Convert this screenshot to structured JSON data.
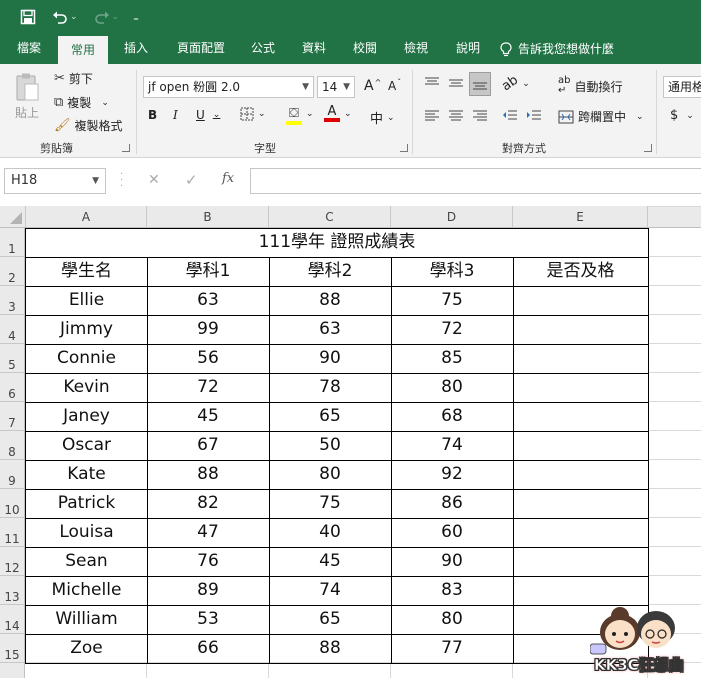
{
  "qat": {
    "save_icon": "save-icon",
    "undo_icon": "undo-icon",
    "redo_icon": "redo-icon",
    "customize_icon": "customize-icon"
  },
  "tabs": [
    {
      "label": "檔案"
    },
    {
      "label": "常用"
    },
    {
      "label": "插入"
    },
    {
      "label": "頁面配置"
    },
    {
      "label": "公式"
    },
    {
      "label": "資料"
    },
    {
      "label": "校閱"
    },
    {
      "label": "檢視"
    },
    {
      "label": "說明"
    },
    {
      "label": "告訴我您想做什麼"
    }
  ],
  "ribbon": {
    "clipboard": {
      "paste": "貼上",
      "cut": "剪下",
      "copy": "複製",
      "format_painter": "複製格式",
      "label": "剪貼簿"
    },
    "font": {
      "name": "jf open 粉圓 2.0",
      "size": "14",
      "grow": "A",
      "shrink": "A",
      "bold": "B",
      "italic": "I",
      "underline": "U",
      "font_color": "A",
      "label": "字型"
    },
    "alignment": {
      "wrap": "自動換行",
      "merge": "跨欄置中",
      "label": "對齊方式"
    },
    "number": {
      "format": "通用格",
      "currency": "$"
    }
  },
  "formula_bar": {
    "name_box": "H18",
    "cancel": "✕",
    "enter": "✓",
    "fx": "fx",
    "value": ""
  },
  "columns": [
    "A",
    "B",
    "C",
    "D",
    "E"
  ],
  "rows": [
    "1",
    "2",
    "3",
    "4",
    "5",
    "6",
    "7",
    "8",
    "9",
    "10",
    "11",
    "12",
    "13",
    "14",
    "15"
  ],
  "sheet": {
    "title": "111學年 證照成績表",
    "headers": [
      "學生名",
      "學科1",
      "學科2",
      "學科3",
      "是否及格"
    ],
    "students": [
      {
        "name": "Ellie",
        "s1": "63",
        "s2": "88",
        "s3": "75"
      },
      {
        "name": "Jimmy",
        "s1": "99",
        "s2": "63",
        "s3": "72"
      },
      {
        "name": "Connie",
        "s1": "56",
        "s2": "90",
        "s3": "85"
      },
      {
        "name": "Kevin",
        "s1": "72",
        "s2": "78",
        "s3": "80"
      },
      {
        "name": "Janey",
        "s1": "45",
        "s2": "65",
        "s3": "68"
      },
      {
        "name": "Oscar",
        "s1": "67",
        "s2": "50",
        "s3": "74"
      },
      {
        "name": "Kate",
        "s1": "88",
        "s2": "80",
        "s3": "92"
      },
      {
        "name": "Patrick",
        "s1": "82",
        "s2": "75",
        "s3": "86"
      },
      {
        "name": "Louisa",
        "s1": "47",
        "s2": "40",
        "s3": "60"
      },
      {
        "name": "Sean",
        "s1": "76",
        "s2": "45",
        "s3": "90"
      },
      {
        "name": "Michelle",
        "s1": "89",
        "s2": "74",
        "s3": "83"
      },
      {
        "name": "William",
        "s1": "53",
        "s2": "65",
        "s3": "80"
      },
      {
        "name": "Zoe",
        "s1": "66",
        "s2": "88",
        "s3": "77"
      }
    ]
  },
  "watermark": {
    "text": "KK3C狂想曲"
  },
  "colors": {
    "excel_green": "#217346",
    "ribbon_bg": "#f3f3f3",
    "header_bg": "#eaeaea"
  }
}
